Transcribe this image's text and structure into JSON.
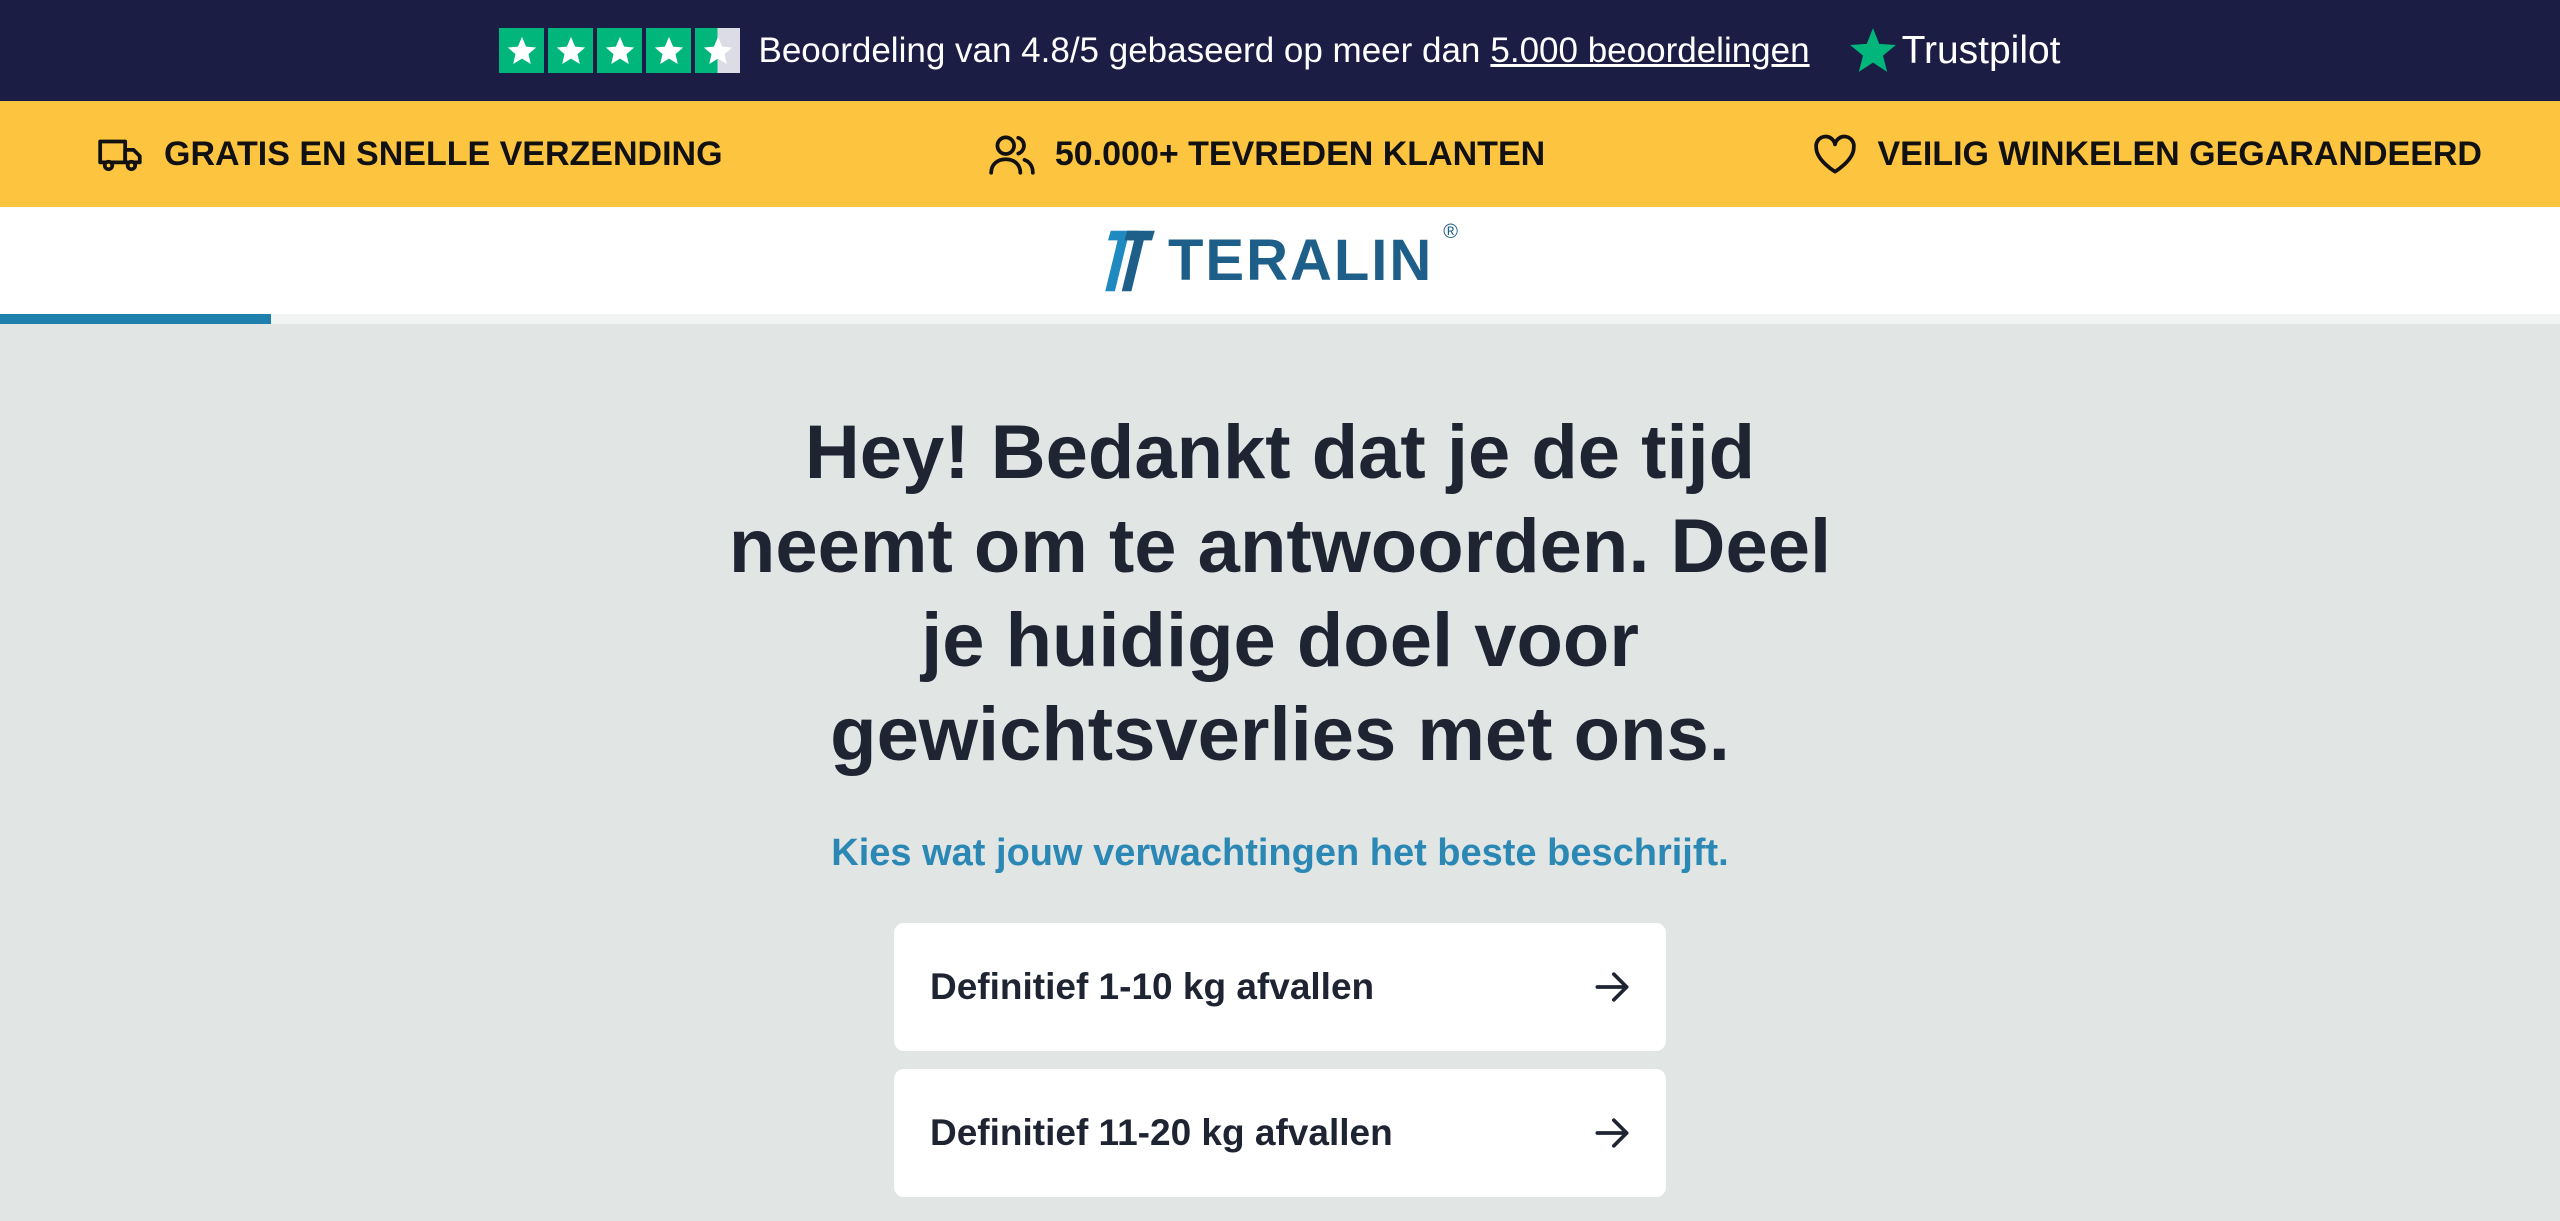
{
  "trustbar": {
    "rating_text": "Beoordeling van 4.8/5 gebaseerd op meer dan",
    "reviews_link": "5.000 beoordelingen",
    "brand": "Trustpilot",
    "stars": 4.5,
    "icons": [
      "star-icon",
      "trustpilot-star-icon"
    ]
  },
  "usps": [
    {
      "icon": "truck-icon",
      "label": "GRATIS EN SNELLE VERZENDING"
    },
    {
      "icon": "users-icon",
      "label": "50.000+ TEVREDEN KLANTEN"
    },
    {
      "icon": "heart-icon",
      "label": "VEILIG WINKELEN GEGARANDEERD"
    }
  ],
  "header": {
    "logo_text": "TERALIN",
    "logo_reg": "®",
    "progress": 0.106
  },
  "main": {
    "headline": "Hey! Bedankt dat je de tijd neemt om te antwoorden. Deel je huidige doel voor gewichtsverlies met ons.",
    "subtitle": "Kies wat jouw verwachtingen het beste beschrijft.",
    "options": [
      {
        "label": "Definitief 1-10 kg afvallen",
        "icon": "arrow-right-icon"
      },
      {
        "label": "Definitief 11-20 kg afvallen",
        "icon": "arrow-right-icon"
      }
    ]
  },
  "colors": {
    "trustbar_bg": "#1c1d45",
    "usp_bg": "#fdc43f",
    "trustpilot_green": "#00b67a",
    "brand_blue": "#1d5f88",
    "accent_blue": "#2b88b4",
    "page_bg": "#e1e5e4"
  }
}
